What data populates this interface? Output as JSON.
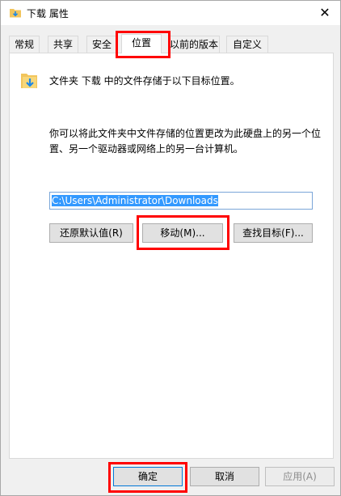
{
  "window": {
    "title": "下载 属性",
    "close_symbol": "✕"
  },
  "tabs": [
    {
      "label": "常规",
      "active": false
    },
    {
      "label": "共享",
      "active": false
    },
    {
      "label": "安全",
      "active": false
    },
    {
      "label": "位置",
      "active": true
    },
    {
      "label": "以前的版本",
      "active": false
    },
    {
      "label": "自定义",
      "active": false
    }
  ],
  "location": {
    "intro": "文件夹 下载 中的文件存储于以下目标位置。",
    "description": "你可以将此文件夹中文件存储的位置更改为此硬盘上的另一个位置、另一个驱动器或网络上的另一台计算机。",
    "path": "C:\\Users\\Administrator\\Downloads"
  },
  "buttons": {
    "restore_default": "还原默认值(R)",
    "move": "移动(M)...",
    "find_target": "查找目标(F)...",
    "ok": "确定",
    "cancel": "取消",
    "apply": "应用(A)"
  },
  "colors": {
    "highlight": "#ff0000",
    "selection": "#3399ff",
    "folder": "#f2c55c",
    "arrow": "#1e88e5"
  }
}
